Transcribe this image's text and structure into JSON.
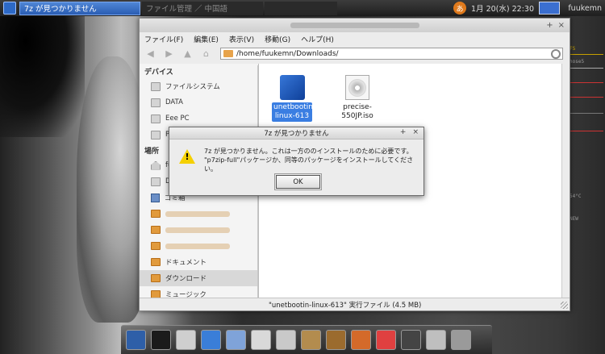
{
  "taskbar": {
    "tasks": [
      {
        "label": "7z が見つかりません"
      },
      {
        "label": "ファイル管理 ／ 中国語"
      },
      {
        "label": ""
      }
    ],
    "clock": "1月 20(水) 22:30",
    "user": "fuukemn"
  },
  "conky": {
    "rows": [
      "FS",
      "",
      "",
      "hose5",
      "",
      "",
      "",
      "",
      "",
      "",
      "",
      "",
      "",
      "",
      "",
      "",
      "",
      "",
      "",
      "",
      "",
      "",
      "",
      "",
      "",
      "",
      "",
      "",
      "",
      "",
      "54°C",
      "",
      "NEW"
    ]
  },
  "file_manager": {
    "menu": [
      "ファイル(F)",
      "編集(E)",
      "表示(V)",
      "移動(G)",
      "ヘルプ(H)"
    ],
    "location": "/home/fuukemn/Downloads/",
    "sidebar": {
      "devices_header": "デバイス",
      "devices": [
        "ファイルシステム",
        "DATA",
        "Eee PC",
        "PI"
      ],
      "places_header": "場所",
      "places": [
        "fu",
        "De",
        "ゴミ箱",
        "",
        "",
        "",
        "ドキュメント",
        "ダウンロード",
        "ミュージック"
      ]
    },
    "files": [
      {
        "name": "unetbootin-linux-613",
        "icon": "unetbootin-icon"
      },
      {
        "name": "precise-550JP.iso",
        "icon": "iso-disc-icon"
      }
    ],
    "status": "\"unetbootin-linux-613\" 実行ファイル (4.5 MB)"
  },
  "dialog": {
    "title": "7z が見つかりません",
    "message_line1": "7z が見つかりません。これは一方ののインストールのために必要です。",
    "message_line2": "\"p7zip-full\"パッケージか、同等のパッケージをインストールしてください。",
    "ok_label": "OK"
  },
  "colors": {
    "accent": "#3a7ee2",
    "folder": "#e19a3c",
    "warning": "#f5d000"
  }
}
